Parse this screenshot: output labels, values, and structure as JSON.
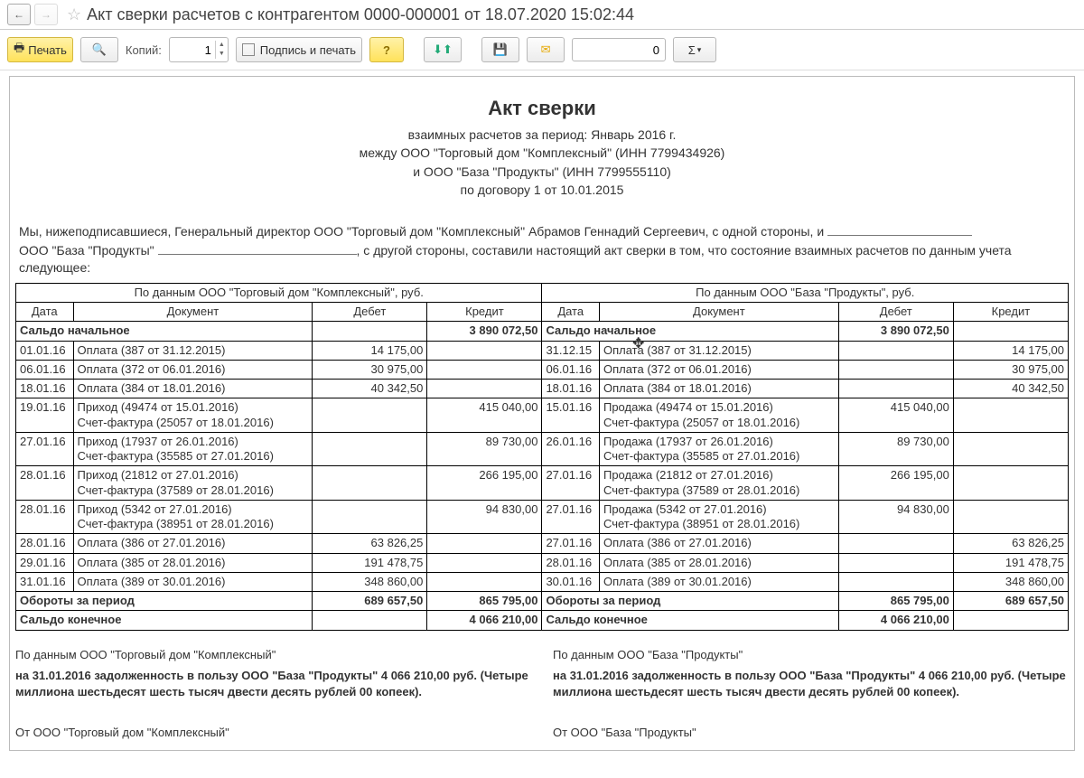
{
  "window": {
    "title": "Акт сверки расчетов с контрагентом 0000-000001 от 18.07.2020 15:02:44"
  },
  "toolbar": {
    "print_label": "Печать",
    "copies_label": "Копий:",
    "copies_value": "1",
    "sign_label": "Подпись и печать",
    "num_value": "0"
  },
  "document": {
    "title": "Акт сверки",
    "sub1": "взаимных расчетов за период: Январь 2016 г.",
    "sub2": "между ООО \"Торговый дом \"Комплексный\" (ИНН 7799434926)",
    "sub3": "и ООО \"База \"Продукты\" (ИНН 7799555110)",
    "sub4": "по договору 1 от 10.01.2015",
    "preamble_a": "Мы, нижеподписавшиеся, Генеральный директор ООО \"Торговый дом \"Комплексный\" Абрамов Геннадий Сергеевич, с одной стороны, и ",
    "preamble_b": "ООО \"База \"Продукты\" ",
    "preamble_c": ", с другой стороны, составили настоящий акт сверки в том, что состояние взаимных расчетов по данным учета следующее:"
  },
  "table": {
    "header_left": "По данным ООО \"Торговый дом \"Комплексный\", руб.",
    "header_right": "По данным ООО \"База \"Продукты\", руб.",
    "col_date": "Дата",
    "col_doc": "Документ",
    "col_debit": "Дебет",
    "col_credit": "Кредит",
    "start_balance_label": "Сальдо начальное",
    "start_balance_left_credit": "3 890 072,50",
    "start_balance_right_debit": "3 890 072,50",
    "rows": [
      {
        "ld": "01.01.16",
        "ldoc": "Оплата (387 от 31.12.2015)",
        "ldeb": "14 175,00",
        "lcr": "",
        "rd": "31.12.15",
        "rdoc": "Оплата (387 от 31.12.2015)",
        "rdeb": "",
        "rcr": "14 175,00"
      },
      {
        "ld": "06.01.16",
        "ldoc": "Оплата (372 от 06.01.2016)",
        "ldeb": "30 975,00",
        "lcr": "",
        "rd": "06.01.16",
        "rdoc": "Оплата (372 от 06.01.2016)",
        "rdeb": "",
        "rcr": "30 975,00"
      },
      {
        "ld": "18.01.16",
        "ldoc": "Оплата (384 от 18.01.2016)",
        "ldeb": "40 342,50",
        "lcr": "",
        "rd": "18.01.16",
        "rdoc": "Оплата (384 от 18.01.2016)",
        "rdeb": "",
        "rcr": "40 342,50"
      },
      {
        "ld": "19.01.16",
        "ldoc": "Приход (49474 от 15.01.2016)\nСчет-фактура (25057 от 18.01.2016)",
        "ldeb": "",
        "lcr": "415 040,00",
        "rd": "15.01.16",
        "rdoc": "Продажа (49474 от 15.01.2016)\nСчет-фактура (25057 от 18.01.2016)",
        "rdeb": "415 040,00",
        "rcr": ""
      },
      {
        "ld": "27.01.16",
        "ldoc": "Приход (17937 от 26.01.2016)\nСчет-фактура (35585 от 27.01.2016)",
        "ldeb": "",
        "lcr": "89 730,00",
        "rd": "26.01.16",
        "rdoc": "Продажа (17937 от 26.01.2016)\nСчет-фактура (35585 от 27.01.2016)",
        "rdeb": "89 730,00",
        "rcr": ""
      },
      {
        "ld": "28.01.16",
        "ldoc": "Приход (21812 от 27.01.2016)\nСчет-фактура (37589 от 28.01.2016)",
        "ldeb": "",
        "lcr": "266 195,00",
        "rd": "27.01.16",
        "rdoc": "Продажа (21812 от 27.01.2016)\nСчет-фактура (37589 от 28.01.2016)",
        "rdeb": "266 195,00",
        "rcr": ""
      },
      {
        "ld": "28.01.16",
        "ldoc": "Приход (5342 от 27.01.2016)\nСчет-фактура (38951 от 28.01.2016)",
        "ldeb": "",
        "lcr": "94 830,00",
        "rd": "27.01.16",
        "rdoc": "Продажа (5342 от 27.01.2016)\nСчет-фактура (38951 от 28.01.2016)",
        "rdeb": "94 830,00",
        "rcr": ""
      },
      {
        "ld": "28.01.16",
        "ldoc": "Оплата (386 от 27.01.2016)",
        "ldeb": "63 826,25",
        "lcr": "",
        "rd": "27.01.16",
        "rdoc": "Оплата (386 от 27.01.2016)",
        "rdeb": "",
        "rcr": "63 826,25"
      },
      {
        "ld": "29.01.16",
        "ldoc": "Оплата (385 от 28.01.2016)",
        "ldeb": "191 478,75",
        "lcr": "",
        "rd": "28.01.16",
        "rdoc": "Оплата (385 от 28.01.2016)",
        "rdeb": "",
        "rcr": "191 478,75"
      },
      {
        "ld": "31.01.16",
        "ldoc": "Оплата (389 от 30.01.2016)",
        "ldeb": "348 860,00",
        "lcr": "",
        "rd": "30.01.16",
        "rdoc": "Оплата (389 от 30.01.2016)",
        "rdeb": "",
        "rcr": "348 860,00"
      }
    ],
    "turnover_label": "Обороты за период",
    "turnover_left_debit": "689 657,50",
    "turnover_left_credit": "865 795,00",
    "turnover_right_debit": "865 795,00",
    "turnover_right_credit": "689 657,50",
    "end_balance_label": "Сальдо конечное",
    "end_balance_left_credit": "4 066 210,00",
    "end_balance_right_debit": "4 066 210,00"
  },
  "footer": {
    "left_lead": "По данным ООО \"Торговый дом \"Комплексный\"",
    "left_debt": "на 31.01.2016 задолженность в пользу ООО \"База \"Продукты\" 4 066 210,00 руб. (Четыре миллиона шестьдесят шесть тысяч двести десять рублей 00 копеек).",
    "left_from": "От ООО \"Торговый дом \"Комплексный\"",
    "right_lead": "По данным ООО \"База \"Продукты\"",
    "right_debt": "на 31.01.2016 задолженность в пользу ООО \"База \"Продукты\" 4 066 210,00 руб. (Четыре миллиона шестьдесят шесть тысяч двести десять рублей 00 копеек).",
    "right_from": "От ООО \"База \"Продукты\""
  }
}
